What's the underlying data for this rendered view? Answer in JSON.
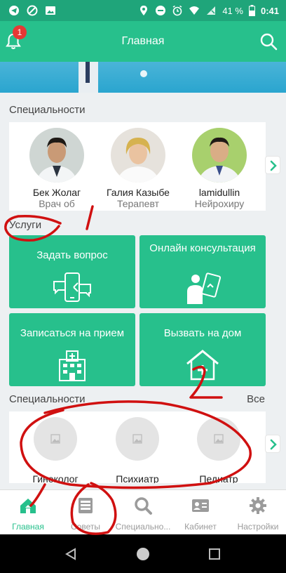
{
  "status_bar": {
    "battery": "41 %",
    "time": "0:41"
  },
  "header": {
    "title": "Главная",
    "notifications_badge": "1"
  },
  "specialists": {
    "title": "Специальности",
    "doctors": [
      {
        "name": "Бек Жолаг",
        "role": "Врач об"
      },
      {
        "name": "Галия Казыбе",
        "role": "Терапевт"
      },
      {
        "name": "lamidullin",
        "role": "Нейрохиру"
      }
    ]
  },
  "services": {
    "title": "Услуги",
    "items": [
      {
        "label": "Задать вопрос"
      },
      {
        "label": "Онлайн консультация"
      },
      {
        "label": "Записаться на прием"
      },
      {
        "label": "Вызвать на дом"
      }
    ]
  },
  "specialties": {
    "title": "Специальности",
    "all_link": "Все",
    "items": [
      {
        "label": "Гинеколог"
      },
      {
        "label": "Психиатр"
      },
      {
        "label": "Педиатр"
      }
    ]
  },
  "bottom_nav": [
    {
      "label": "Главная",
      "icon": "home-icon",
      "active": true
    },
    {
      "label": "Советы",
      "icon": "tips-icon"
    },
    {
      "label": "Специально...",
      "icon": "search-icon"
    },
    {
      "label": "Кабинет",
      "icon": "profile-card-icon"
    },
    {
      "label": "Настройки",
      "icon": "gear-icon"
    }
  ],
  "annotations": {
    "numbers": [
      "1",
      "2"
    ]
  },
  "colors": {
    "primary": "#27c08c",
    "status": "#1fa57a",
    "badge": "#e53935",
    "annotation": "#d01010"
  }
}
